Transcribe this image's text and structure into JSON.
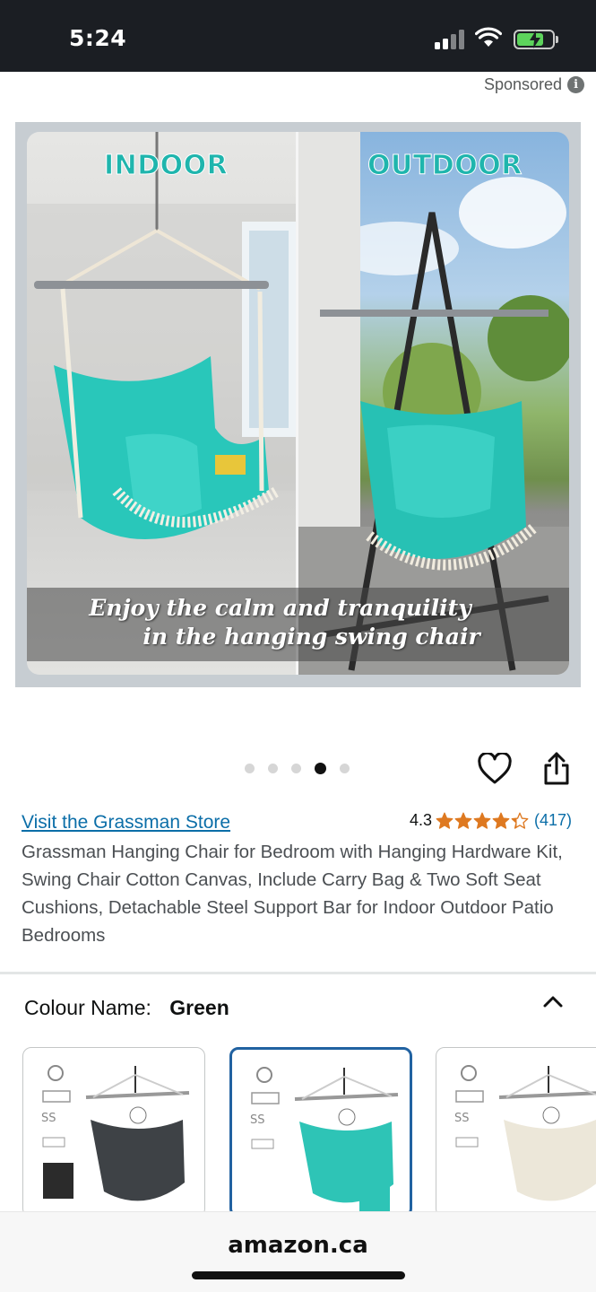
{
  "status_bar": {
    "time": "5:24"
  },
  "ad": {
    "sponsored_label": "Sponsored"
  },
  "product_image": {
    "indoor_label": "INDOOR",
    "outdoor_label": "OUTDOOR",
    "caption_line1": "Enjoy the calm and tranquility",
    "caption_line2": "in the hanging swing chair",
    "image_count": 5,
    "active_index": 3
  },
  "product": {
    "store_link": "Visit the Grassman Store",
    "rating_value": "4.3",
    "rating_stars": 4.3,
    "rating_count": "(417)",
    "title": "Grassman Hanging Chair for Bedroom with Hanging Hardware Kit, Swing Chair Cotton Canvas, Include Carry Bag & Two Soft Seat Cushions, Detachable Steel Support Bar for Indoor Outdoor Patio Bedrooms"
  },
  "variations": {
    "colour_label": "Colour Name:",
    "colour_value": "Green",
    "swatches": [
      {
        "color": "#3e4246",
        "selected": false
      },
      {
        "color": "#2ec4b6",
        "selected": true
      },
      {
        "color": "#ece7d9",
        "selected": false
      }
    ]
  },
  "browser": {
    "url": "amazon.ca"
  },
  "colors": {
    "link": "#0b6ea8",
    "star": "#de7921",
    "accent_teal": "#1fb5ad",
    "selected_border": "#2162a1"
  }
}
